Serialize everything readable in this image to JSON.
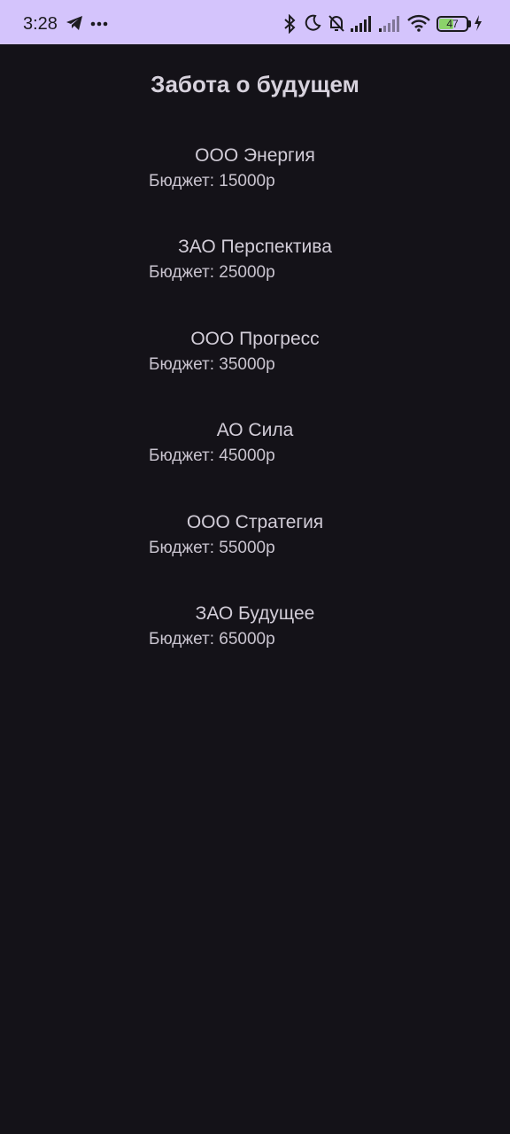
{
  "status_bar": {
    "time": "3:28",
    "battery": "47",
    "icons": [
      "telegram-icon",
      "more-dots-icon",
      "bluetooth-icon",
      "moon-icon",
      "bell-off-icon",
      "signal-icon",
      "signal-icon-2",
      "wifi-icon",
      "battery-icon",
      "charging-icon"
    ]
  },
  "page": {
    "title": "Забота о будущем"
  },
  "companies": [
    {
      "name": "ООО Энергия",
      "budget": "Бюджет: 15000р"
    },
    {
      "name": "ЗАО Перспектива",
      "budget": "Бюджет: 25000р"
    },
    {
      "name": "ООО Прогресс",
      "budget": "Бюджет: 35000р"
    },
    {
      "name": "АО Сила",
      "budget": "Бюджет: 45000р"
    },
    {
      "name": "ООО Стратегия",
      "budget": "Бюджет: 55000р"
    },
    {
      "name": "ЗАО Будущее",
      "budget": "Бюджет: 65000р"
    }
  ],
  "colors": {
    "status_bar_bg": "#d4c4fc",
    "background": "#141218",
    "text": "#d2cdd8",
    "battery_fill": "#8bd36a"
  }
}
